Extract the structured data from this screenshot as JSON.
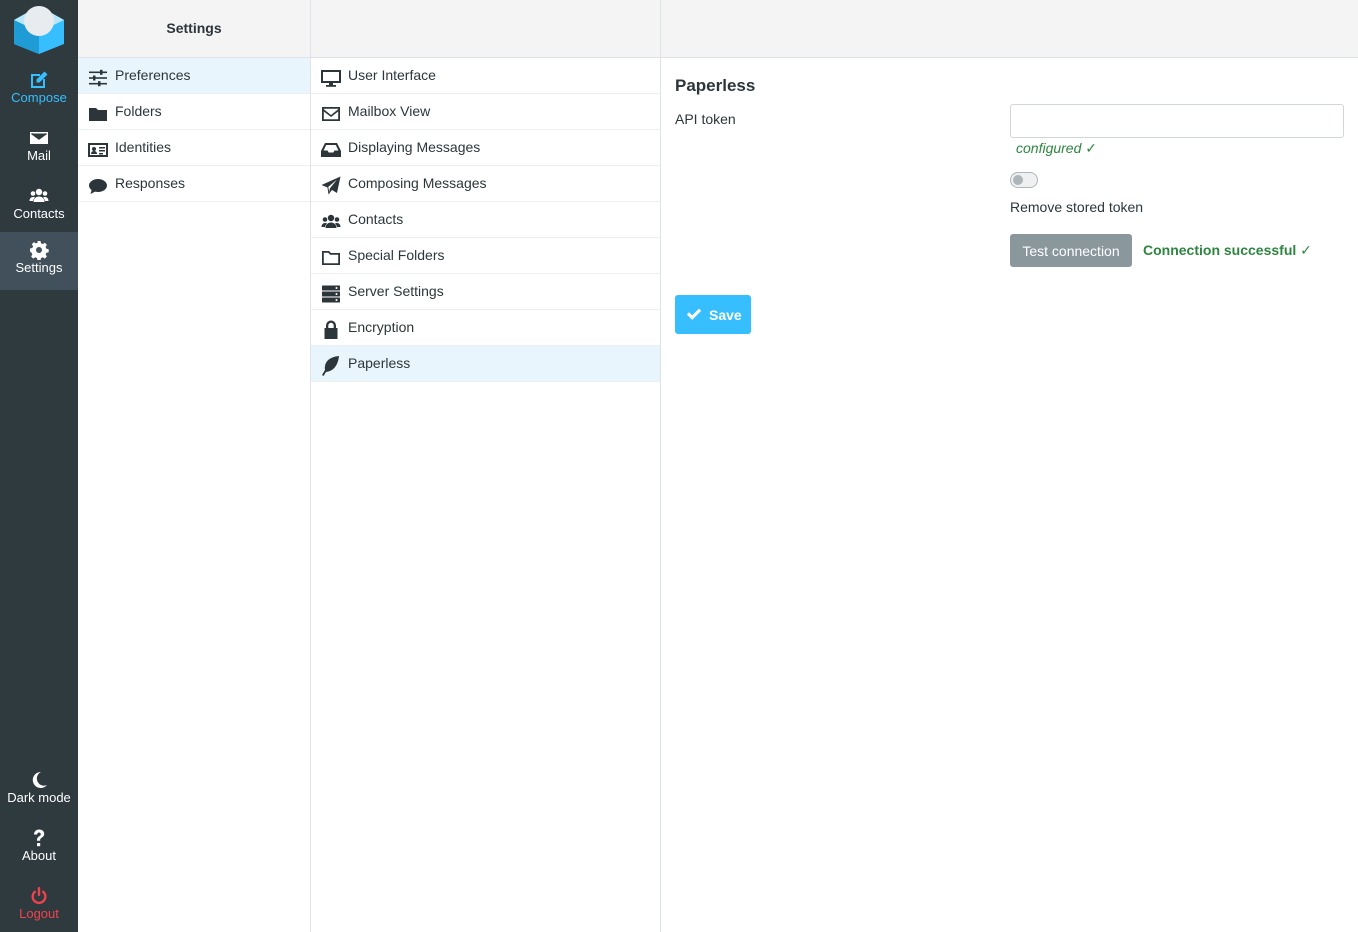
{
  "nav": {
    "compose": "Compose",
    "mail": "Mail",
    "contacts": "Contacts",
    "settings": "Settings",
    "dark_mode": "Dark mode",
    "about": "About",
    "logout": "Logout"
  },
  "sections": {
    "header": "Settings",
    "items": [
      {
        "label": "Preferences",
        "icon": "sliders-icon"
      },
      {
        "label": "Folders",
        "icon": "folder-icon"
      },
      {
        "label": "Identities",
        "icon": "id-card-icon"
      },
      {
        "label": "Responses",
        "icon": "comment-icon"
      }
    ]
  },
  "preferences": {
    "items": [
      {
        "label": "User Interface",
        "icon": "desktop-icon"
      },
      {
        "label": "Mailbox View",
        "icon": "envelope-icon"
      },
      {
        "label": "Displaying Messages",
        "icon": "inbox-icon"
      },
      {
        "label": "Composing Messages",
        "icon": "paper-plane-icon"
      },
      {
        "label": "Contacts",
        "icon": "users-icon"
      },
      {
        "label": "Special Folders",
        "icon": "folder-open-icon"
      },
      {
        "label": "Server Settings",
        "icon": "server-icon"
      },
      {
        "label": "Encryption",
        "icon": "lock-icon"
      },
      {
        "label": "Paperless",
        "icon": "leaf-icon"
      }
    ]
  },
  "paperless": {
    "title": "Paperless",
    "api_token_label": "API token",
    "api_token_value": "",
    "configured_note": "configured ✓",
    "remove_label": "Remove stored token",
    "remove_checked": false,
    "test_button": "Test connection",
    "connection_status": "Connection successful ✓",
    "save_button": "Save"
  },
  "colors": {
    "accent": "#37beff",
    "rail": "#2f3a3f",
    "success": "#2e8540",
    "danger": "#f3424e",
    "selected_row": "#e9f5fc"
  }
}
